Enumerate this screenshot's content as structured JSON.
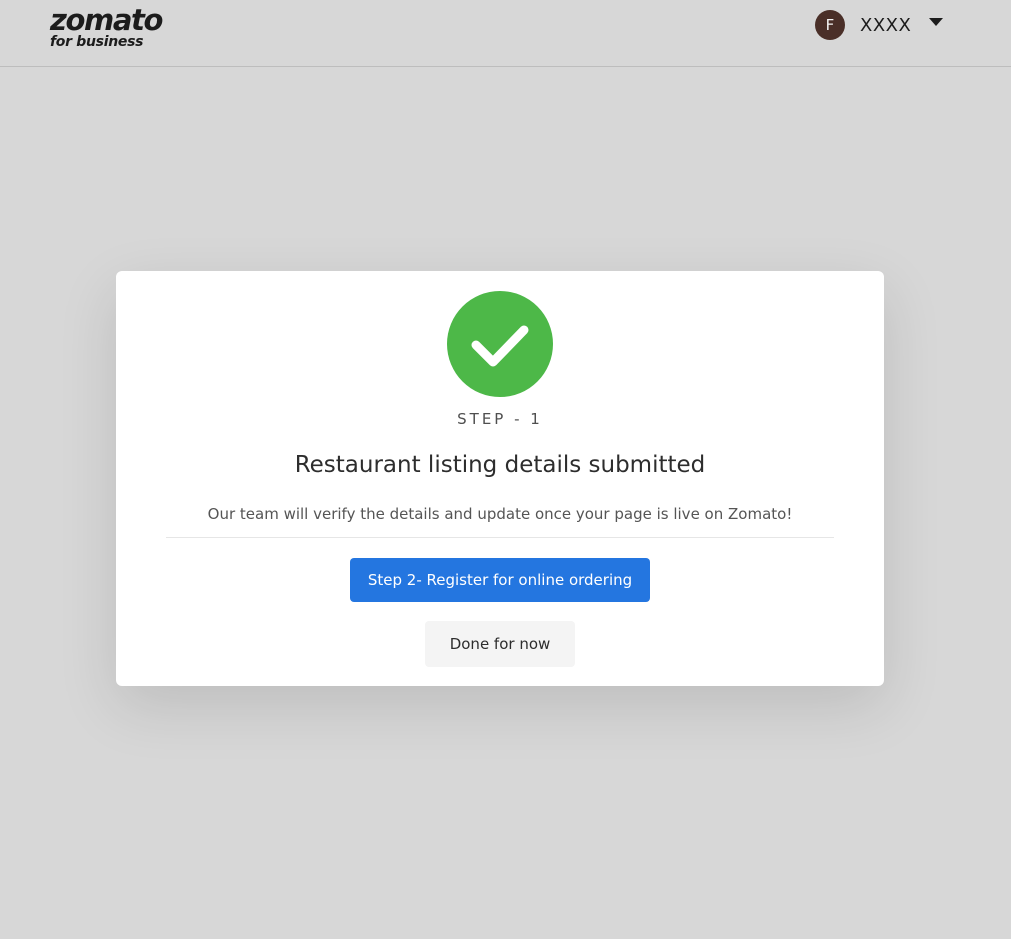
{
  "header": {
    "logo_main": "zomato",
    "logo_sub": "for business",
    "user": {
      "avatar_initial": "F",
      "name": "XXXX"
    }
  },
  "modal": {
    "icon": "check-circle-icon",
    "step_label": "STEP - 1",
    "title": "Restaurant listing details submitted",
    "description": "Our team will verify the details and update once your page is live on Zomato!",
    "primary_button": "Step 2- Register for online ordering",
    "secondary_button": "Done for now"
  },
  "colors": {
    "background": "#d7d7d7",
    "success": "#4db848",
    "primary": "#2476e0",
    "avatar": "#4a2f28"
  }
}
